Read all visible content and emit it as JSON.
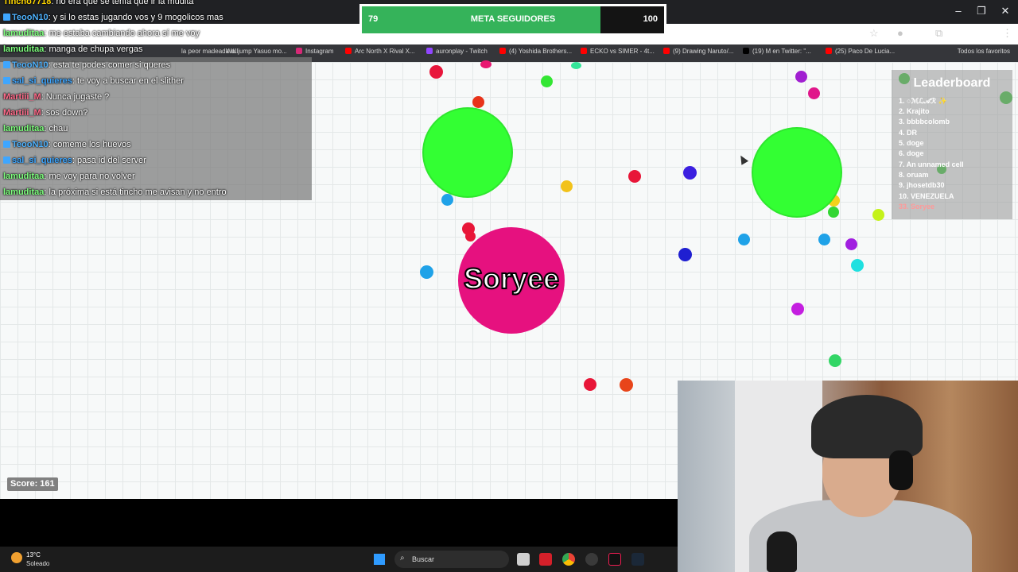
{
  "goal_bar": {
    "current": "79",
    "title": "META SEGUIDORES",
    "max": "100",
    "fraction": 0.79
  },
  "chat": [
    {
      "user": "Tincho7718",
      "msg": ": no era que se tenía que ir la mudita"
    },
    {
      "user": "TeooN10",
      "msg": ": y si lo estas jugando vos y 9 mogolicos mas"
    },
    {
      "user": "lamuditaa",
      "msg": ": me estaba cambiando ahora sí me voy"
    },
    {
      "user": "lamuditaa",
      "msg": ": manga de chupa vergas"
    },
    {
      "user": "TeooN10",
      "msg": ": esta te podes comer si queres"
    },
    {
      "user": "sal_si_quieres",
      "msg": ": te voy a buscar en el slither"
    },
    {
      "user": "Martiii_M",
      "msg": ": Nunca jugaste ?"
    },
    {
      "user": "Martiii_M",
      "msg": ": sos down?"
    },
    {
      "user": "lamuditaa",
      "msg": ": chau"
    },
    {
      "user": "TeooN10",
      "msg": ": comeme los huevos"
    },
    {
      "user": "sal_si_quieres",
      "msg": ": pasa id del server"
    },
    {
      "user": "lamuditaa",
      "msg": ": me voy para no volver"
    },
    {
      "user": "lamuditaa",
      "msg": ": la próxima si está tincho me avisan y no entro"
    }
  ],
  "bookmarks": [
    "la peor madeada d...",
    "Walljump Yasuo mo...",
    "Instagram",
    "Arc North X Rival X...",
    "auronplay - Twitch",
    "(4) Yoshida Brothers...",
    "ECKO vs SIMER - 4t...",
    "(9) Drawing Naruto/...",
    "(19) M en Twitter: \"...",
    "(25) Paco De Lucia..."
  ],
  "bookmarks_folder": "Todos los favoritos",
  "leaderboard": {
    "title": "Leaderboard",
    "entries": [
      "1. ○ℳℒ𝒜ℛ ✨",
      "2. Krajito",
      "3. bbbbcolomb",
      "4. DR",
      "5. doge",
      "6. doge",
      "7. An unnamed cell",
      "8. oruam",
      "9. jhosetdb30",
      "10. VENEZUELA",
      "33. Soryee"
    ]
  },
  "player": {
    "name": "Soryee",
    "color": "#e6117f"
  },
  "score": "Score: 161",
  "taskbar": {
    "weather_temp": "13°C",
    "weather_desc": "Soleado",
    "search": "Buscar"
  },
  "colors": {
    "virus": "#33ff33",
    "goal_fill": "#35b35a",
    "chat_bg": "#787878"
  },
  "icons": [
    "search-icon",
    "windows-start-icon",
    "chrome-icon",
    "steam-icon",
    "tiktok-icon",
    "star-icon",
    "extensions-icon",
    "minimize-icon",
    "maximize-icon",
    "close-icon"
  ]
}
